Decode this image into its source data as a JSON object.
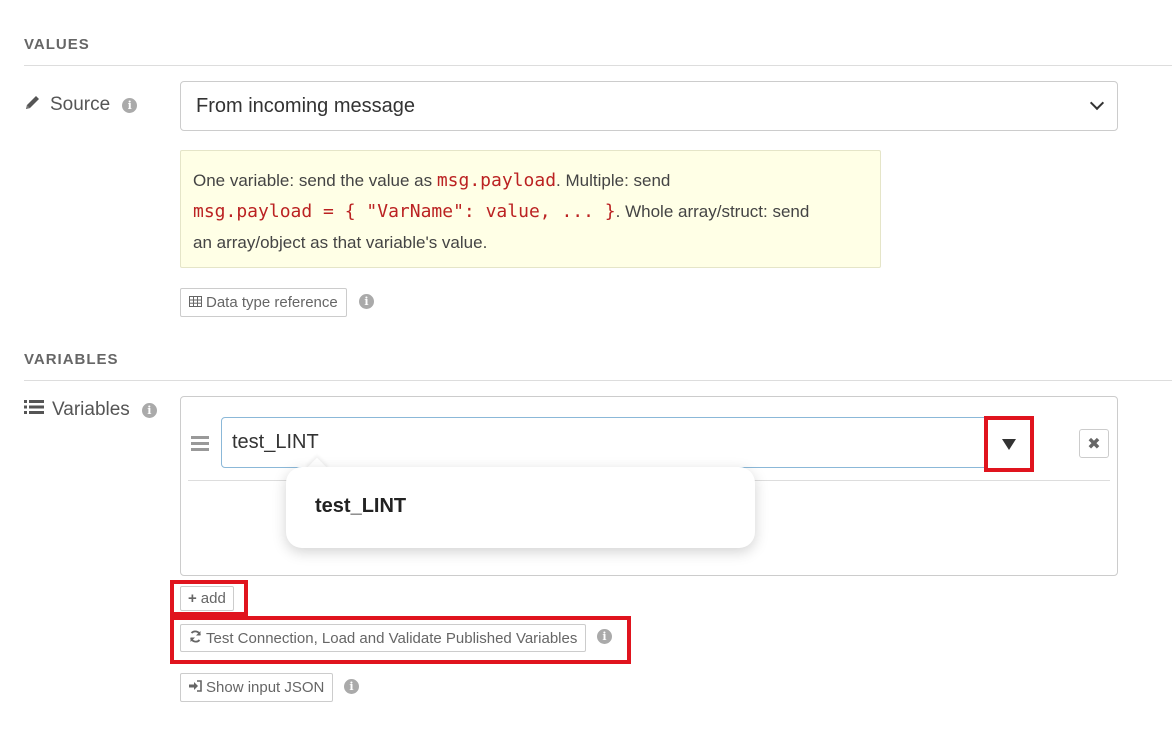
{
  "values_section": {
    "title": "VALUES",
    "source_label": "Source",
    "source_value": "From incoming message",
    "tip_text_1": "One variable: send the value as ",
    "tip_code_1": "msg.payload",
    "tip_text_2": ". Multiple: send",
    "tip_code_2": "msg.payload = { \"VarName\": value, ... }",
    "tip_text_3": ". Whole array/struct: send",
    "tip_text_4": "an array/object as that variable's value.",
    "data_type_button": "Data type reference"
  },
  "variables_section": {
    "title": "VARIABLES",
    "variables_label": "Variables",
    "variable_value": "test_LINT",
    "dropdown_option": "test_LINT",
    "add_button": "add",
    "test_connection_button": "Test Connection, Load and Validate Published Variables",
    "show_json_button": "Show input JSON"
  },
  "icons": {
    "pencil": "pencil-icon",
    "list": "list-icon",
    "info": "info-icon",
    "table": "table-icon",
    "plus": "plus-icon",
    "refresh": "refresh-icon",
    "sign_in": "sign-in-icon",
    "remove": "remove-icon",
    "dropdown": "caret-down-icon"
  },
  "colors": {
    "highlight": "#e0141e",
    "tip_bg": "#ffffe6",
    "code": "#b22222"
  }
}
